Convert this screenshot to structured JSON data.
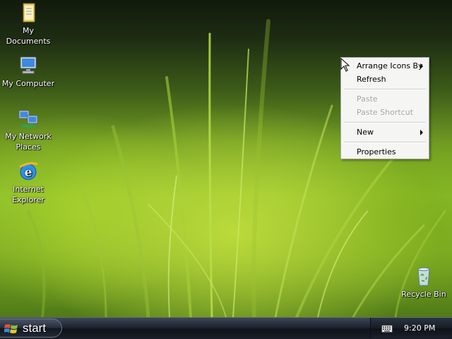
{
  "desktop": {
    "icons": [
      {
        "label_lines": [
          "My Documents"
        ],
        "icon": "my-documents-icon"
      },
      {
        "label_lines": [
          "My Computer"
        ],
        "icon": "my-computer-icon"
      },
      {
        "label_lines": [
          "My Network",
          "Places"
        ],
        "icon": "my-network-places-icon"
      },
      {
        "label_lines": [
          "Internet",
          "Explorer"
        ],
        "icon": "internet-explorer-icon"
      },
      {
        "label_lines": [
          "Recycle Bin"
        ],
        "icon": "recycle-bin-icon"
      }
    ]
  },
  "context_menu": {
    "items": [
      {
        "label": "Arrange Icons By",
        "enabled": true,
        "submenu": true
      },
      {
        "label": "Refresh",
        "enabled": true,
        "submenu": false
      },
      {
        "label": "Paste",
        "enabled": false,
        "submenu": false
      },
      {
        "label": "Paste Shortcut",
        "enabled": false,
        "submenu": false
      },
      {
        "label": "New",
        "enabled": true,
        "submenu": true
      },
      {
        "label": "Properties",
        "enabled": true,
        "submenu": false
      }
    ]
  },
  "taskbar": {
    "start_label": "start",
    "clock": "9:20 PM",
    "tray_icons": [
      "keyboard-icon"
    ]
  },
  "colors": {
    "menu_bg": "#f5f5f3",
    "disabled_text": "#a4a4a4",
    "taskbar_dark": "#1e2430"
  }
}
